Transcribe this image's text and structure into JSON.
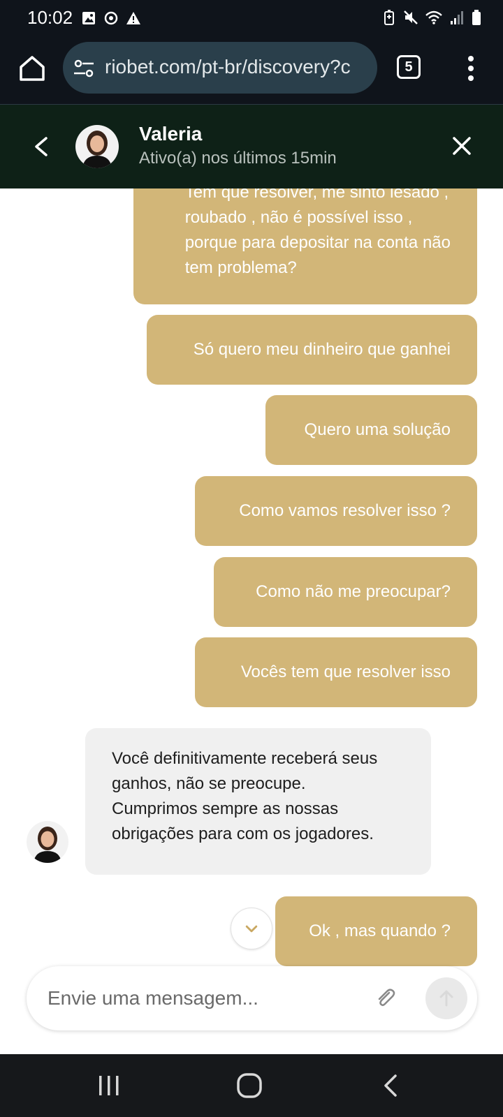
{
  "status_bar": {
    "time": "10:02",
    "left_icons": [
      "gallery-icon",
      "sync-icon",
      "warning-icon"
    ],
    "right_icons": [
      "battery-saver-icon",
      "mute-icon",
      "wifi-icon",
      "signal-icon",
      "battery-icon"
    ]
  },
  "browser": {
    "url": "riobet.com/pt-br/discovery?c",
    "tab_count": "5"
  },
  "chat_header": {
    "agent_name": "Valeria",
    "agent_status": "Ativo(a) nos últimos 15min"
  },
  "messages": [
    {
      "direction": "out",
      "lines": [
        "Tem que resolver, me sinto lesado ,",
        "roubado , não é possível isso ,",
        "porque para depositar na conta não",
        "tem problema?"
      ]
    },
    {
      "direction": "out",
      "text": "Só quero meu dinheiro que ganhei"
    },
    {
      "direction": "out",
      "text": "Quero uma solução"
    },
    {
      "direction": "out",
      "text": "Como vamos resolver isso ?"
    },
    {
      "direction": "out",
      "text": "Como não me preocupar?"
    },
    {
      "direction": "out",
      "text": "Vocês tem que resolver isso"
    },
    {
      "direction": "in",
      "lines": [
        "Você definitivamente receberá seus",
        "ganhos, não se preocupe.",
        "Cumprimos sempre as nossas",
        "obrigações para com os jogadores."
      ]
    },
    {
      "direction": "out",
      "text": "Ok , mas quando ?"
    }
  ],
  "composer": {
    "placeholder": "Envie uma mensagem..."
  },
  "colors": {
    "outgoing_bubble": "#d2b678",
    "incoming_bubble": "#f0f0f0",
    "chat_header_bg": "#0e2117",
    "browser_bg": "#0f141b",
    "url_pill_bg": "#2a3f4b"
  }
}
